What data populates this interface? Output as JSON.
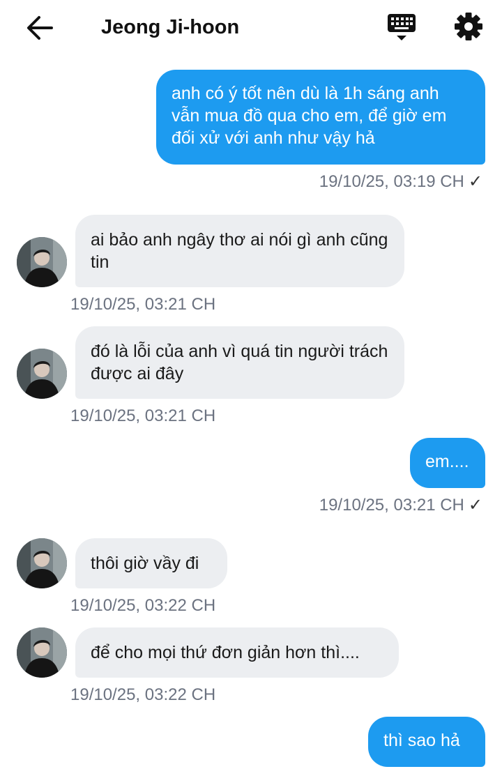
{
  "header": {
    "title": "Jeong Ji-hoon",
    "back_icon": "arrow-left-icon",
    "keyboard_icon": "keyboard-icon",
    "settings_icon": "gear-icon"
  },
  "colors": {
    "outgoing_bubble": "#1d9bf0",
    "incoming_bubble": "#eceef1",
    "timestamp": "#6b7280"
  },
  "messages": [
    {
      "direction": "out",
      "text": "anh có ý tốt nên dù là 1h sáng anh vẫn mua đồ qua cho em, để giờ em đối xử với anh như vậy hả",
      "time": "19/10/25, 03:19 CH",
      "read": "✓"
    },
    {
      "direction": "in",
      "text": "ai bảo anh ngây thơ ai nói gì anh cũng tin",
      "time": "19/10/25, 03:21 CH"
    },
    {
      "direction": "in",
      "text": "đó là lỗi của anh vì quá tin người trách được ai đây",
      "time": "19/10/25, 03:21 CH"
    },
    {
      "direction": "out",
      "text": "em....",
      "time": "19/10/25, 03:21 CH",
      "read": "✓"
    },
    {
      "direction": "in",
      "text": "thôi giờ vầy đi",
      "time": "19/10/25, 03:22 CH"
    },
    {
      "direction": "in",
      "text": "để cho mọi thứ đơn giản hơn thì....",
      "time": "19/10/25, 03:22 CH"
    },
    {
      "direction": "out",
      "text": "thì sao hả"
    }
  ]
}
